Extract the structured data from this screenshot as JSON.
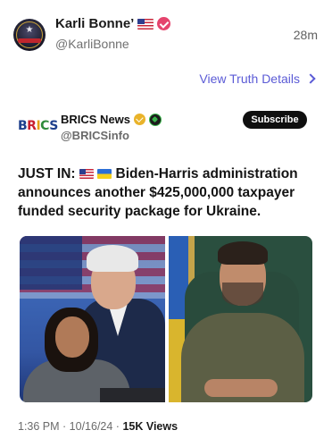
{
  "author": {
    "display_name": "Karli Bonne’",
    "handle": "@KarliBonne",
    "time_ago": "28m",
    "flag_icon": "us-flag-icon",
    "verified_color": "#e5446d"
  },
  "details_link": {
    "label": "View Truth Details"
  },
  "embed": {
    "logo_letters": [
      "B",
      "R",
      "I",
      "C",
      "S"
    ],
    "name": "BRICS News",
    "handle": "@BRICSinfo",
    "subscribe_label": "Subscribe",
    "text_prefix": "JUST IN:",
    "text_body": "Biden-Harris administration announces another $425,000,000 taxpayer funded security package for Ukraine.",
    "meta_time": "1:36 PM · 10/16/24 · ",
    "meta_views": "15K",
    "meta_views_label": " Views"
  },
  "colors": {
    "link": "#5b5bd6",
    "subscribe_bg": "#0f0f0f",
    "brics_blue": "#1d3f8c",
    "brics_red": "#c8202f",
    "brics_gold": "#e6a019",
    "brics_green": "#2e8b3a"
  }
}
